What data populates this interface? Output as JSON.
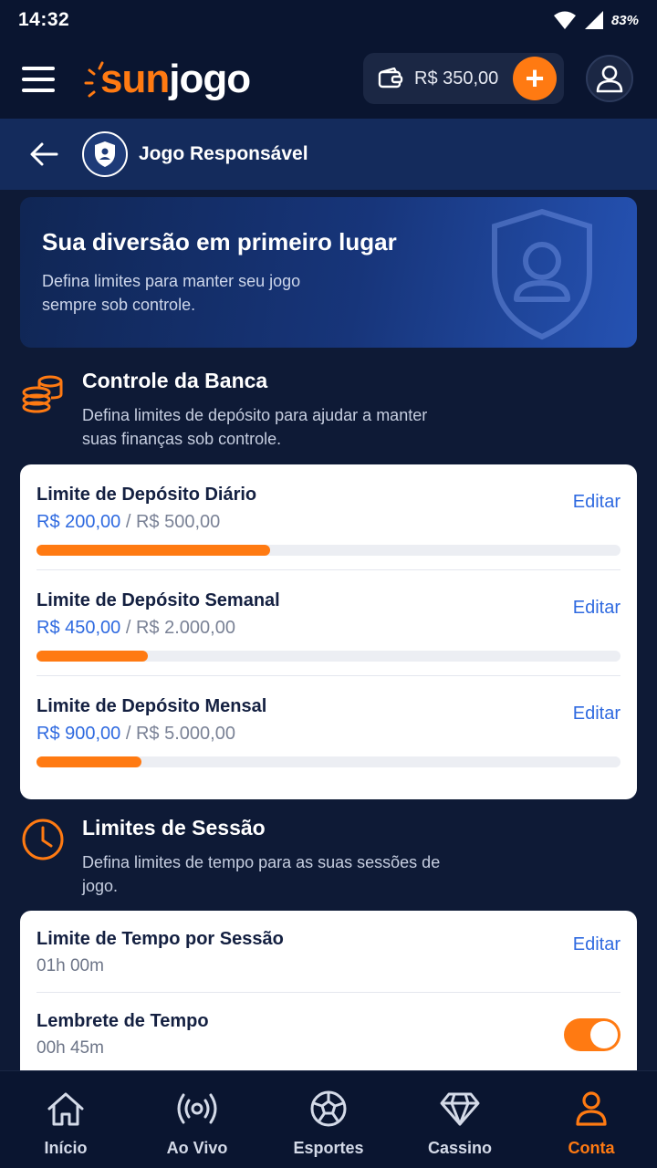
{
  "status_bar": {
    "time": "14:32",
    "battery": "83%"
  },
  "header": {
    "logo_sun": "sun",
    "logo_jogo": "jogo",
    "wallet_balance": "R$ 350,00",
    "add_funds": "+"
  },
  "subheader": {
    "title": "Jogo Responsável"
  },
  "hero": {
    "title": "Sua diversão em primeiro lugar",
    "subtitle": "Defina limites para manter seu jogo sempre sob controle."
  },
  "bank_section": {
    "title": "Controle da Banca",
    "description": "Defina limites de depósito para ajudar a manter suas finanças sob controle.",
    "items": [
      {
        "label": "Limite de Depósito Diário",
        "current": "R$ 200,00",
        "separator": " / ",
        "limit": "R$ 500,00",
        "edit": "Editar",
        "progress": 0.4
      },
      {
        "label": "Limite de Depósito Semanal",
        "current": "R$ 450,00",
        "separator": " / ",
        "limit": "R$ 2.000,00",
        "edit": "Editar",
        "progress": 0.19
      },
      {
        "label": "Limite de Depósito Mensal",
        "current": "R$ 900,00",
        "separator": " / ",
        "limit": "R$ 5.000,00",
        "edit": "Editar",
        "progress": 0.18
      }
    ]
  },
  "session_section": {
    "title": "Limites de Sessão",
    "description": "Defina limites de tempo para as suas sessões de jogo.",
    "items": [
      {
        "label": "Limite de Tempo por Sessão",
        "value": "01h 00m",
        "edit": "Editar"
      },
      {
        "label": "Lembrete de Tempo",
        "value": "00h 45m",
        "toggle_on": true
      }
    ]
  },
  "bottom_nav": [
    {
      "label": "Início",
      "icon": "home-icon",
      "active": false
    },
    {
      "label": "Ao Vivo",
      "icon": "live-broadcast-icon",
      "active": false
    },
    {
      "label": "Esportes",
      "icon": "soccer-ball-icon",
      "active": false
    },
    {
      "label": "Cassino",
      "icon": "diamond-icon",
      "active": false
    },
    {
      "label": "Conta",
      "icon": "user-icon",
      "active": true
    }
  ],
  "colors": {
    "accent": "#ff7a12",
    "link": "#2f6ae0",
    "background": "#0e1a36"
  }
}
